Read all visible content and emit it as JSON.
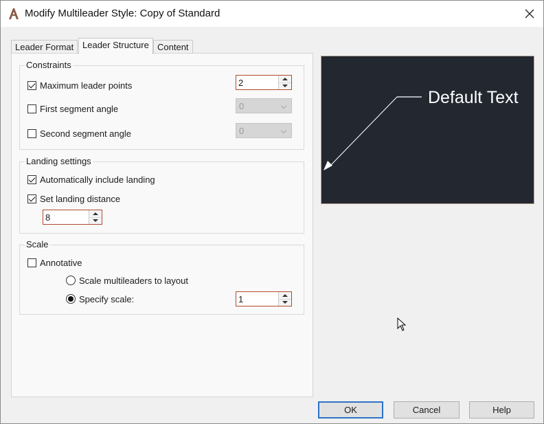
{
  "window": {
    "title": "Modify Multileader Style: Copy of Standard",
    "close_glyph": "✕",
    "app_icon": "autocad-a-icon"
  },
  "tabs": [
    {
      "label": "Leader Format",
      "active": false
    },
    {
      "label": "Leader Structure",
      "active": true
    },
    {
      "label": "Content",
      "active": false
    }
  ],
  "constraints": {
    "title": "Constraints",
    "max_leader_points": {
      "label": "Maximum leader points",
      "checked": true,
      "value": "2"
    },
    "first_segment_angle": {
      "label": "First segment angle",
      "checked": false,
      "value": "0",
      "enabled": false
    },
    "second_segment_angle": {
      "label": "Second segment angle",
      "checked": false,
      "value": "0",
      "enabled": false
    }
  },
  "landing": {
    "title": "Landing settings",
    "auto_include": {
      "label": "Automatically include landing",
      "checked": true
    },
    "set_distance": {
      "label": "Set landing distance",
      "checked": true,
      "value": "8"
    }
  },
  "scale": {
    "title": "Scale",
    "annotative": {
      "label": "Annotative",
      "checked": false
    },
    "scale_to_layout": {
      "label": "Scale multileaders to layout",
      "selected": false
    },
    "specify_scale": {
      "label": "Specify scale:",
      "selected": true,
      "value": "1"
    }
  },
  "preview": {
    "text": "Default Text",
    "background": "#222730",
    "line_color": "#ffffff"
  },
  "buttons": {
    "ok": "OK",
    "cancel": "Cancel",
    "help": "Help"
  },
  "colors": {
    "accent_border": "#b04a2c",
    "default_button_border": "#2a73c8"
  }
}
